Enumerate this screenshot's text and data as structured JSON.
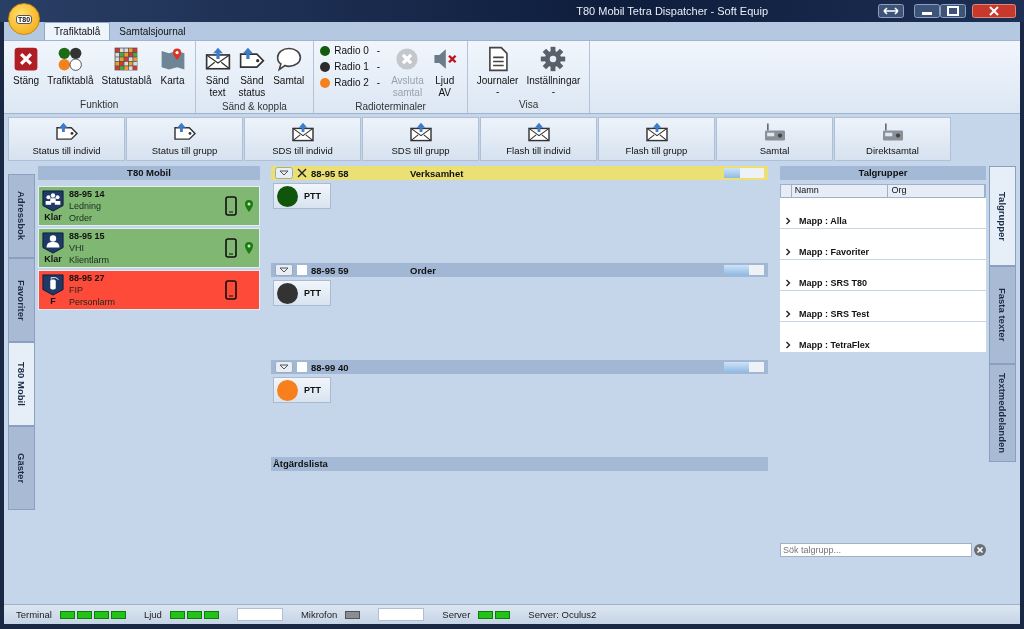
{
  "window": {
    "title": "T80 Mobil Tetra Dispatcher - Soft Equip",
    "logo": "T80"
  },
  "ribbon_tabs": [
    {
      "label": "Trafiktablå",
      "selected": true
    },
    {
      "label": "Samtalsjournal",
      "selected": false
    }
  ],
  "ribbon_groups": [
    {
      "title": "Funktion",
      "items": [
        {
          "kind": "button",
          "label": "Stäng",
          "disabled": false
        },
        {
          "kind": "button",
          "label": "Trafiktablå",
          "disabled": false
        },
        {
          "kind": "button",
          "label": "Statustablå",
          "disabled": false
        },
        {
          "kind": "button",
          "label": "Karta",
          "disabled": false
        }
      ]
    },
    {
      "title": "Sänd & koppla",
      "items": [
        {
          "kind": "button",
          "label": "Sänd text",
          "disabled": false
        },
        {
          "kind": "button",
          "label": "Sänd status",
          "disabled": false
        },
        {
          "kind": "button",
          "label": "Samtal",
          "disabled": false
        }
      ]
    },
    {
      "title": "Radioterminaler",
      "items": [
        {
          "kind": "radios",
          "radios": [
            {
              "label": "Radio 0",
              "color": "#145a0c",
              "caret": "-"
            },
            {
              "label": "Radio 1",
              "color": "#2b2b2b",
              "caret": "-"
            },
            {
              "label": "Radio 2",
              "color": "#f5801e",
              "caret": "-"
            }
          ]
        },
        {
          "kind": "button",
          "label": "Avsluta samtal",
          "disabled": true
        },
        {
          "kind": "button",
          "label": "Ljud AV",
          "disabled": false
        }
      ]
    },
    {
      "title": "Visa",
      "items": [
        {
          "kind": "button",
          "label": "Journaler",
          "caret": "-",
          "disabled": false
        },
        {
          "kind": "button",
          "label": "Inställningar",
          "caret": "-",
          "disabled": false
        }
      ]
    }
  ],
  "action_buttons": [
    "Status till individ",
    "Status till grupp",
    "SDS till individ",
    "SDS till grupp",
    "Flash till individ",
    "Flash till grupp",
    "Samtal",
    "Direktsamtal"
  ],
  "left_tabs": [
    {
      "label": "Adressbok",
      "selected": false
    },
    {
      "label": "Favoriter",
      "selected": false
    },
    {
      "label": "T80 Mobil",
      "selected": true
    },
    {
      "label": "Gäster",
      "selected": false
    }
  ],
  "unit_panel": {
    "title": "T80 Mobil",
    "units": [
      {
        "number": "88-95 14",
        "name": "Ledning",
        "state": "Klar",
        "status": "Order",
        "color": "#80b873",
        "gps": true
      },
      {
        "number": "88-95 15",
        "name": "VHI",
        "state": "Klar",
        "status": "Klientlarm",
        "color": "#80b873",
        "gps": true
      },
      {
        "number": "88-95 27",
        "name": "FIP",
        "state": "F",
        "status": "Personlarm",
        "color": "#fe4a38",
        "gps": false
      }
    ]
  },
  "talkgroups": [
    {
      "number": "88-95 58",
      "name": "Verksamhet",
      "active": true,
      "checked": true,
      "level": 0.4,
      "ptt": "PTT",
      "color": "#0f560b"
    },
    {
      "number": "88-95 59",
      "name": "Order",
      "active": false,
      "checked": false,
      "level": 0.62,
      "ptt": "PTT",
      "color": "#333333"
    },
    {
      "number": "88-99 40",
      "active": false,
      "checked": false,
      "level": 0.62,
      "ptt": "PTT",
      "color": "#f7801c"
    }
  ],
  "action_list": {
    "title": "Åtgärdslista"
  },
  "talkgroup_panel": {
    "title": "Talgrupper",
    "columns": [
      "Namn",
      "Org"
    ],
    "folders": [
      "Mapp : Alla",
      "Mapp : Favoriter",
      "Mapp : SRS T80",
      "Mapp : SRS Test",
      "Mapp : TetraFlex"
    ],
    "search": {
      "placeholder": "Sök talgrupp..."
    }
  },
  "right_tabs": [
    {
      "label": "Talgrupper",
      "selected": true
    },
    {
      "label": "Fasta texter",
      "selected": false
    },
    {
      "label": "Textmeddelanden",
      "selected": false
    }
  ],
  "status_bar": [
    {
      "kind": "leds",
      "label": "Terminal",
      "leds": [
        {
          "on": true
        },
        {
          "on": true
        },
        {
          "on": true
        },
        {
          "on": true
        }
      ]
    },
    {
      "kind": "leds",
      "label": "Ljud",
      "leds": [
        {
          "on": true
        },
        {
          "on": true
        },
        {
          "on": true
        }
      ],
      "field": true
    },
    {
      "kind": "leds",
      "label": "Mikrofon",
      "leds": [
        {
          "on": false
        }
      ],
      "field": true
    },
    {
      "kind": "leds",
      "label": "Server",
      "leds": [
        {
          "on": true
        },
        {
          "on": true
        }
      ]
    },
    {
      "kind": "text",
      "label": "Server: Oculus2"
    }
  ]
}
